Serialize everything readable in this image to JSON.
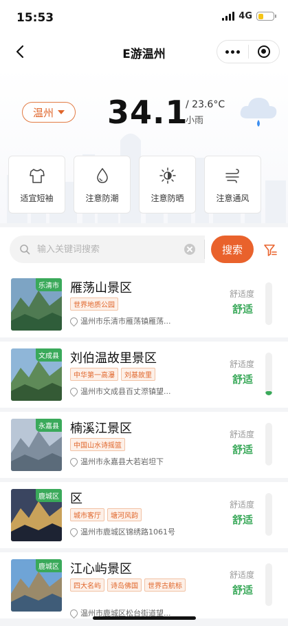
{
  "status_bar": {
    "time": "15:53",
    "network": "4G",
    "battery_level": 0.35
  },
  "nav": {
    "title": "E游温州"
  },
  "weather": {
    "city": "温州",
    "temperature": "34.1",
    "range": "/ 23.6°C",
    "condition": "小雨",
    "icon": "rain-cloud-icon"
  },
  "tips": [
    {
      "label": "适宜短袖",
      "icon": "tshirt-icon"
    },
    {
      "label": "注意防潮",
      "icon": "water-drop-icon"
    },
    {
      "label": "注意防晒",
      "icon": "sun-icon"
    },
    {
      "label": "注意通风",
      "icon": "wind-icon"
    }
  ],
  "search": {
    "placeholder": "输入关键词搜索",
    "button": "搜索"
  },
  "spots": [
    {
      "district": "乐清市",
      "name": "雁荡山景区",
      "tags": [
        "世界地质公园"
      ],
      "address": "温州市乐清市雁荡镇雁荡...",
      "comfort_label": "舒适度",
      "comfort": "舒适",
      "comfort_level": 0
    },
    {
      "district": "文成县",
      "name": "刘伯温故里景区",
      "tags": [
        "中华第一高瀑",
        "刘基故里"
      ],
      "address": "温州市文成县百丈漈镇望...",
      "comfort_label": "舒适度",
      "comfort": "舒适",
      "comfort_level": 0.1
    },
    {
      "district": "永嘉县",
      "name": "楠溪江景区",
      "tags": [
        "中国山水诗摇篮"
      ],
      "address": "温州市永嘉县大若岩坦下",
      "comfort_label": "舒适度",
      "comfort": "舒适",
      "comfort_level": 0
    },
    {
      "district": "鹿城区",
      "name": "区",
      "tags": [
        "城市客厅",
        "塘河风韵"
      ],
      "address": "温州市鹿城区锦绣路1061号",
      "comfort_label": "舒适度",
      "comfort": "舒适",
      "comfort_level": 0
    },
    {
      "district": "鹿城区",
      "name": "江心屿景区",
      "tags": [
        "四大名屿",
        "诗岛佛国",
        "世界古航标"
      ],
      "address": "温州市鹿城区松台街道望...",
      "comfort_label": "舒适度",
      "comfort": "舒适",
      "comfort_level": 0
    }
  ],
  "colors": {
    "accent": "#e9622c",
    "comfort": "#3aa95a"
  }
}
